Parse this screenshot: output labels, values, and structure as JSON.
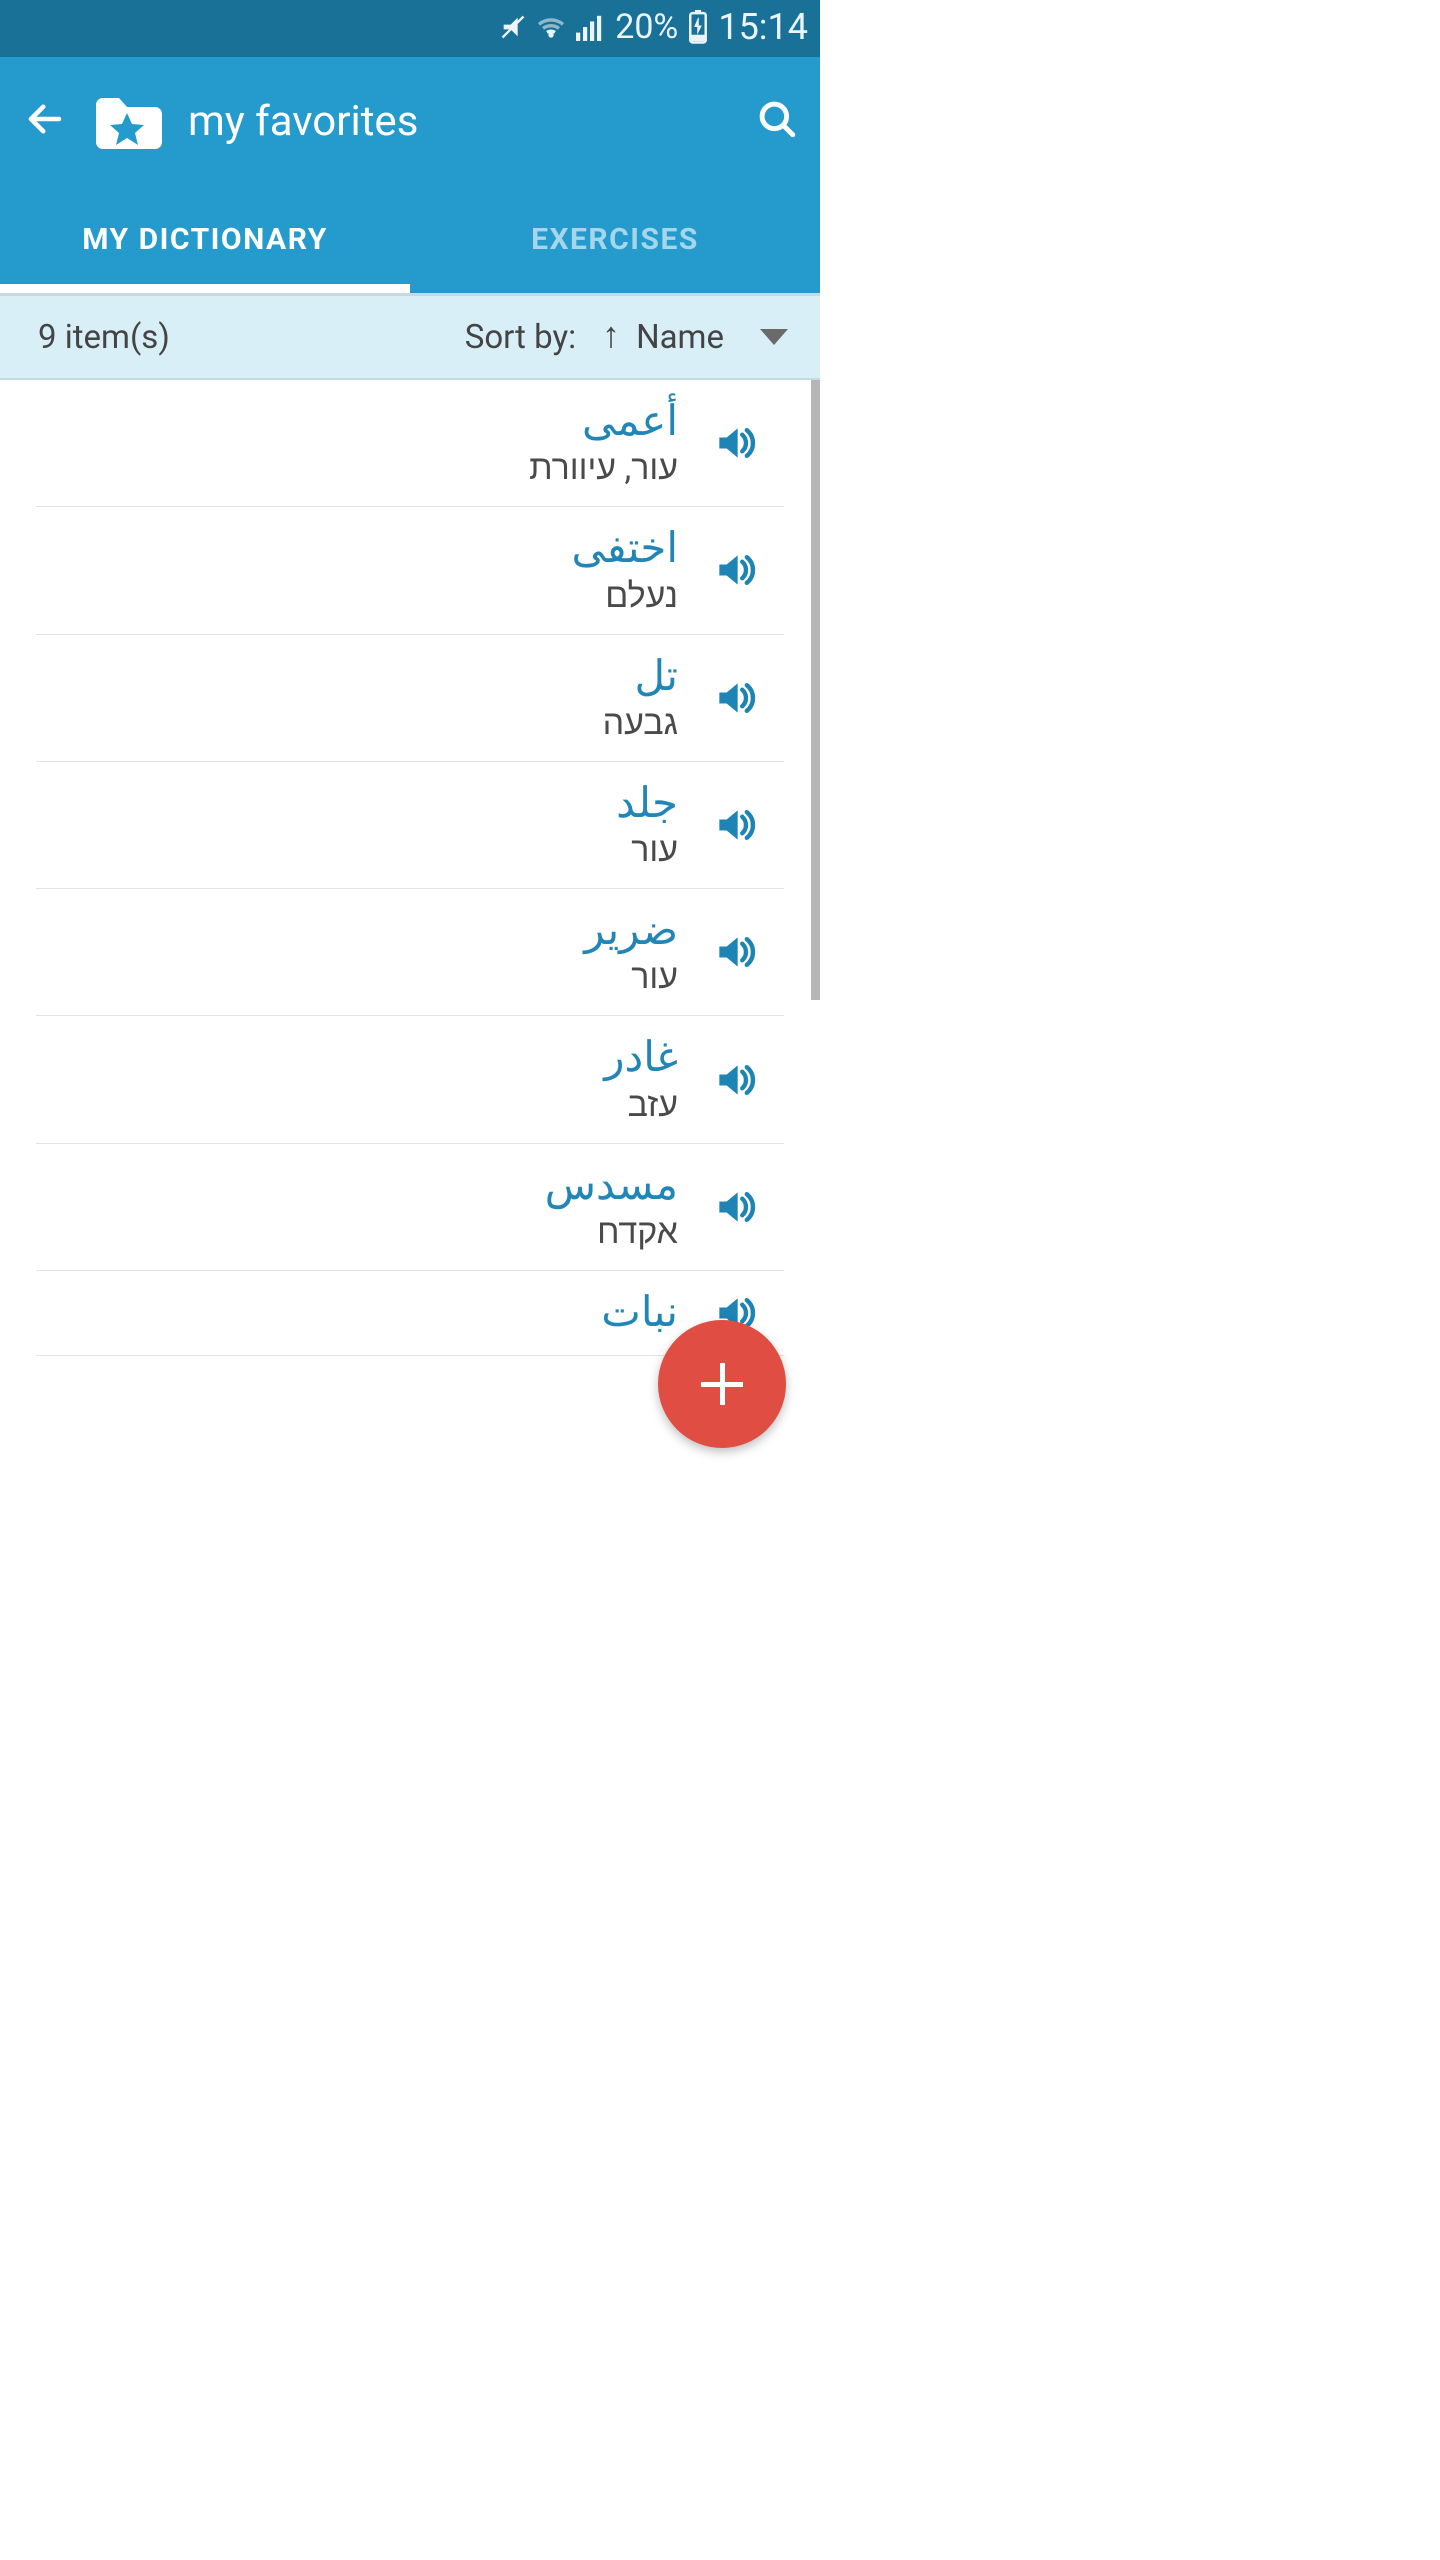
{
  "status": {
    "battery_pct": "20%",
    "time": "15:14"
  },
  "header": {
    "title": "my favorites"
  },
  "tabs": [
    {
      "label": "MY DICTIONARY",
      "active": true
    },
    {
      "label": "EXERCISES",
      "active": false
    }
  ],
  "sort": {
    "count": "9 item(s)",
    "label": "Sort by:",
    "direction_icon": "↑",
    "field": "Name"
  },
  "items": [
    {
      "word": "أعمى",
      "translation": "עור, עיוורת"
    },
    {
      "word": "اختفى",
      "translation": "נעלם"
    },
    {
      "word": "تل",
      "translation": "גבעה"
    },
    {
      "word": "جلد",
      "translation": "עור"
    },
    {
      "word": "ضرير",
      "translation": "עור"
    },
    {
      "word": "غادر",
      "translation": "עזב"
    },
    {
      "word": "مسدس",
      "translation": "אקדח"
    },
    {
      "word": "نبات",
      "translation": ""
    }
  ]
}
